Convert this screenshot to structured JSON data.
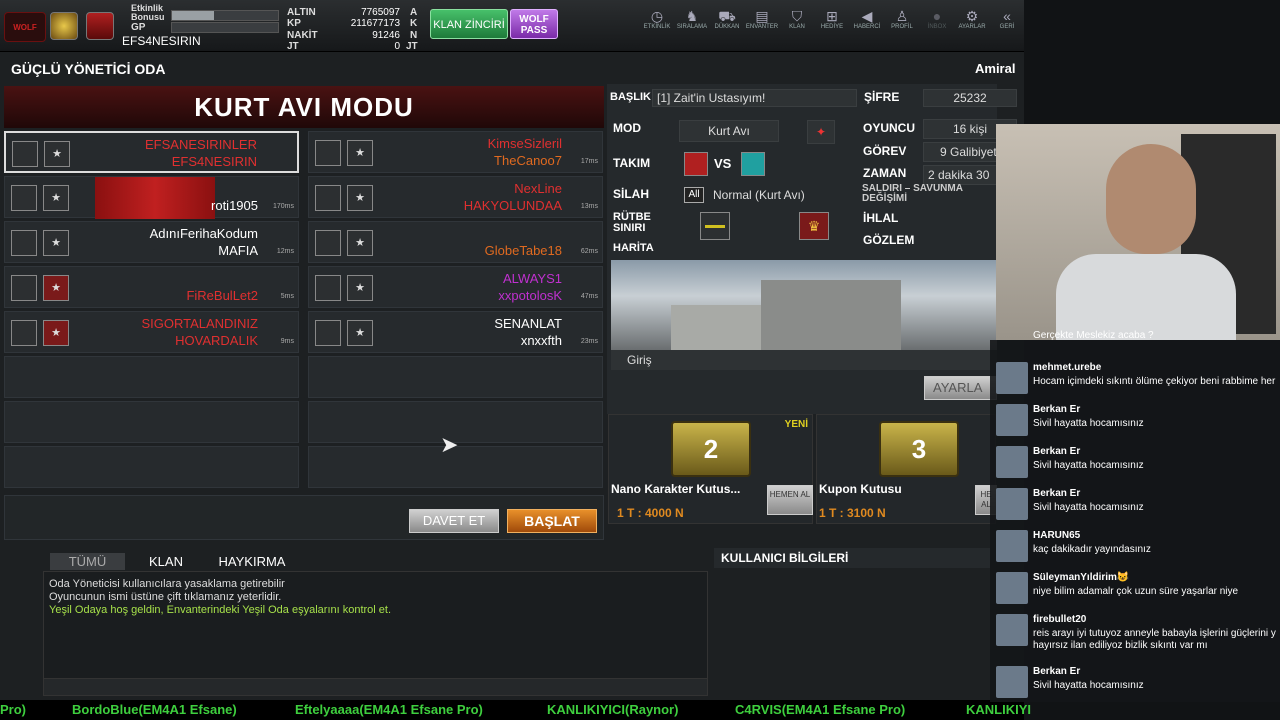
{
  "topbar": {
    "etkinlik": "Etkinlik",
    "bonusu": "Bonusu",
    "gp": "GP",
    "username": "EFS4NESIRIN",
    "altin_lbl": "ALTIN",
    "altin": "7765097",
    "altin_u": "A",
    "kp_lbl": "KP",
    "kp": "211677173",
    "kp_u": "K",
    "nakit_lbl": "NAKİT",
    "nakit": "91246",
    "nakit_u": "N",
    "jt_lbl": "JT",
    "jt": "0",
    "jt_u": "JT",
    "klan_btn": "KLAN ZİNCİRİ",
    "wolf_btn": "WOLF PASS",
    "nav": [
      "ETKİNLİK",
      "SIRALAMA",
      "DÜKKAN",
      "ENVANTER",
      "KLAN",
      "HEDİYE",
      "HABERCİ",
      "PROFİL",
      "İNBOX",
      "AYARLAR",
      "GERİ"
    ]
  },
  "room": {
    "title": "GÜÇLÜ YÖNETİCİ ODA",
    "rank": "Amiral",
    "mode_title": "KURT AVI MODU"
  },
  "red_team": [
    {
      "name1": "EFSANESIRINLER",
      "name2": "EFS4NESIRIN",
      "ms": ""
    },
    {
      "name1": "",
      "name2": "roti1905",
      "ms": "170ms"
    },
    {
      "name1": "AdınıFerihaKodum",
      "name2": "MAFIA",
      "ms": "12ms"
    },
    {
      "name1": "",
      "name2": "FiReBulLet2",
      "ms": "5ms"
    },
    {
      "name1": "SIGORTALANDINIZ",
      "name2": "HOVARDALIK",
      "ms": "9ms"
    }
  ],
  "blue_team": [
    {
      "name1": "KimseSizleril",
      "name2": "TheCanoo7",
      "ms": "17ms"
    },
    {
      "name1": "NexLine",
      "name2": "HAKYOLUNDAA",
      "ms": "13ms"
    },
    {
      "name1": "",
      "name2": "GlobeTabe18",
      "ms": "62ms"
    },
    {
      "name1": "ALWAYS1",
      "name2": "xxpotolosK",
      "ms": "47ms"
    },
    {
      "name1": "SENANLAT",
      "name2": "xnxxfth",
      "ms": "23ms"
    }
  ],
  "buttons": {
    "davet": "DAVET ET",
    "baslat": "BAŞLAT",
    "ayarlar": "AYARLA"
  },
  "info": {
    "baslik_lbl": "BAŞLIK",
    "baslik": "[1] Zait'in Ustasıyım!",
    "sifre_lbl": "ŞİFRE",
    "sifre": "25232",
    "mod_lbl": "MOD",
    "mod": "Kurt Avı",
    "oyuncu_lbl": "OYUNCU",
    "oyuncu": "16 kişi",
    "takim_lbl": "TAKIM",
    "vs": "VS",
    "gorev_lbl": "GÖREV",
    "gorev": "9 Galibiyet",
    "silah_lbl": "SİLAH",
    "silah_all": "All",
    "silah": "Normal (Kurt Avı)",
    "zaman_lbl": "ZAMAN",
    "zaman": "2 dakika 30",
    "saldiri": "SALDIRI – SAVUNMA DEĞİŞİMİ",
    "rutbe_lbl": "RÜTBE SINIRI",
    "ihlal": "İHLAL",
    "harita_lbl": "HARİTA",
    "gozlem": "GÖZLEM",
    "map_name": "Giriş"
  },
  "shop": [
    {
      "name": "Nano Karakter Kutus...",
      "price": "1 T : 4000 N",
      "num": "2",
      "badge": "YENİ",
      "btn": "HEMEN AL"
    },
    {
      "name": "Kupon Kutusu",
      "price": "1 T : 3100 N",
      "num": "3",
      "btn": "HE AL"
    }
  ],
  "chatpanel": {
    "tabs": [
      "TÜMÜ",
      "KLAN",
      "HAYKIRMA"
    ],
    "lines": [
      "Oda Yöneticisi kullanıcılara yasaklama getirebilir",
      "Oyuncunun ismi üstüne çift tıklamanız yeterlidir.",
      "Yeşil Odaya hoş geldin, Envanterindeki Yeşil Oda eşyalarını kontrol et."
    ],
    "user_info": "KULLANICI BİLGİLERİ"
  },
  "ticker": [
    "Pro)",
    "BordoBlue(EM4A1 Efsane)",
    "Eftelyaaaa(EM4A1 Efsane Pro)",
    "KANLIKIYICI(Raynor)",
    "C4RVIS(EM4A1 Efsane Pro)",
    "KANLIKIYI"
  ],
  "stream_chat": [
    {
      "user": "",
      "text": "Gerçekte Meslekiz acaba ?"
    },
    {
      "user": "mehmet.urebe",
      "text": "Hocam içimdeki sıkıntı ölüme çekiyor beni rabbime her"
    },
    {
      "user": "Berkan Er",
      "text": "Sivil hayatta hocamısınız"
    },
    {
      "user": "Berkan Er",
      "text": "Sivil hayatta hocamısınız"
    },
    {
      "user": "Berkan Er",
      "text": "Sivil hayatta hocamısınız"
    },
    {
      "user": "HARUN65",
      "text": "kaç dakikadır yayındasınız"
    },
    {
      "user": "SüleymanYıldirim😺",
      "text": "niye bilim adamalr çok uzun süre yaşarlar niye"
    },
    {
      "user": "firebullet20",
      "text": "reis arayı iyi tutuyoz anneyle babayla işlerini güçlerini y",
      "text2": "hayırsız ilan ediliyoz bizlik sıkıntı var mı"
    },
    {
      "user": "Berkan Er",
      "text": "Sivil hayatta hocamısınız"
    }
  ]
}
